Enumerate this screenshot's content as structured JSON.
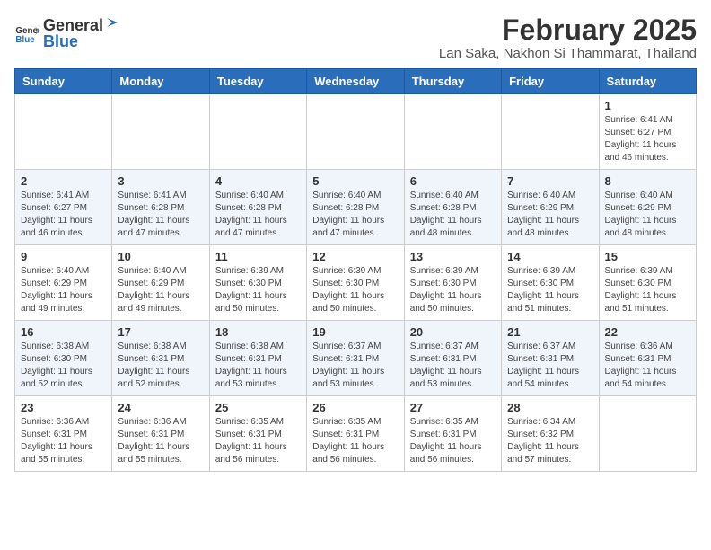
{
  "header": {
    "logo_general": "General",
    "logo_blue": "Blue",
    "month_year": "February 2025",
    "location": "Lan Saka, Nakhon Si Thammarat, Thailand"
  },
  "weekdays": [
    "Sunday",
    "Monday",
    "Tuesday",
    "Wednesday",
    "Thursday",
    "Friday",
    "Saturday"
  ],
  "weeks": [
    [
      {
        "day": "",
        "info": ""
      },
      {
        "day": "",
        "info": ""
      },
      {
        "day": "",
        "info": ""
      },
      {
        "day": "",
        "info": ""
      },
      {
        "day": "",
        "info": ""
      },
      {
        "day": "",
        "info": ""
      },
      {
        "day": "1",
        "info": "Sunrise: 6:41 AM\nSunset: 6:27 PM\nDaylight: 11 hours and 46 minutes."
      }
    ],
    [
      {
        "day": "2",
        "info": "Sunrise: 6:41 AM\nSunset: 6:27 PM\nDaylight: 11 hours and 46 minutes."
      },
      {
        "day": "3",
        "info": "Sunrise: 6:41 AM\nSunset: 6:28 PM\nDaylight: 11 hours and 47 minutes."
      },
      {
        "day": "4",
        "info": "Sunrise: 6:40 AM\nSunset: 6:28 PM\nDaylight: 11 hours and 47 minutes."
      },
      {
        "day": "5",
        "info": "Sunrise: 6:40 AM\nSunset: 6:28 PM\nDaylight: 11 hours and 47 minutes."
      },
      {
        "day": "6",
        "info": "Sunrise: 6:40 AM\nSunset: 6:28 PM\nDaylight: 11 hours and 48 minutes."
      },
      {
        "day": "7",
        "info": "Sunrise: 6:40 AM\nSunset: 6:29 PM\nDaylight: 11 hours and 48 minutes."
      },
      {
        "day": "8",
        "info": "Sunrise: 6:40 AM\nSunset: 6:29 PM\nDaylight: 11 hours and 48 minutes."
      }
    ],
    [
      {
        "day": "9",
        "info": "Sunrise: 6:40 AM\nSunset: 6:29 PM\nDaylight: 11 hours and 49 minutes."
      },
      {
        "day": "10",
        "info": "Sunrise: 6:40 AM\nSunset: 6:29 PM\nDaylight: 11 hours and 49 minutes."
      },
      {
        "day": "11",
        "info": "Sunrise: 6:39 AM\nSunset: 6:30 PM\nDaylight: 11 hours and 50 minutes."
      },
      {
        "day": "12",
        "info": "Sunrise: 6:39 AM\nSunset: 6:30 PM\nDaylight: 11 hours and 50 minutes."
      },
      {
        "day": "13",
        "info": "Sunrise: 6:39 AM\nSunset: 6:30 PM\nDaylight: 11 hours and 50 minutes."
      },
      {
        "day": "14",
        "info": "Sunrise: 6:39 AM\nSunset: 6:30 PM\nDaylight: 11 hours and 51 minutes."
      },
      {
        "day": "15",
        "info": "Sunrise: 6:39 AM\nSunset: 6:30 PM\nDaylight: 11 hours and 51 minutes."
      }
    ],
    [
      {
        "day": "16",
        "info": "Sunrise: 6:38 AM\nSunset: 6:30 PM\nDaylight: 11 hours and 52 minutes."
      },
      {
        "day": "17",
        "info": "Sunrise: 6:38 AM\nSunset: 6:31 PM\nDaylight: 11 hours and 52 minutes."
      },
      {
        "day": "18",
        "info": "Sunrise: 6:38 AM\nSunset: 6:31 PM\nDaylight: 11 hours and 53 minutes."
      },
      {
        "day": "19",
        "info": "Sunrise: 6:37 AM\nSunset: 6:31 PM\nDaylight: 11 hours and 53 minutes."
      },
      {
        "day": "20",
        "info": "Sunrise: 6:37 AM\nSunset: 6:31 PM\nDaylight: 11 hours and 53 minutes."
      },
      {
        "day": "21",
        "info": "Sunrise: 6:37 AM\nSunset: 6:31 PM\nDaylight: 11 hours and 54 minutes."
      },
      {
        "day": "22",
        "info": "Sunrise: 6:36 AM\nSunset: 6:31 PM\nDaylight: 11 hours and 54 minutes."
      }
    ],
    [
      {
        "day": "23",
        "info": "Sunrise: 6:36 AM\nSunset: 6:31 PM\nDaylight: 11 hours and 55 minutes."
      },
      {
        "day": "24",
        "info": "Sunrise: 6:36 AM\nSunset: 6:31 PM\nDaylight: 11 hours and 55 minutes."
      },
      {
        "day": "25",
        "info": "Sunrise: 6:35 AM\nSunset: 6:31 PM\nDaylight: 11 hours and 56 minutes."
      },
      {
        "day": "26",
        "info": "Sunrise: 6:35 AM\nSunset: 6:31 PM\nDaylight: 11 hours and 56 minutes."
      },
      {
        "day": "27",
        "info": "Sunrise: 6:35 AM\nSunset: 6:31 PM\nDaylight: 11 hours and 56 minutes."
      },
      {
        "day": "28",
        "info": "Sunrise: 6:34 AM\nSunset: 6:32 PM\nDaylight: 11 hours and 57 minutes."
      },
      {
        "day": "",
        "info": ""
      }
    ]
  ]
}
